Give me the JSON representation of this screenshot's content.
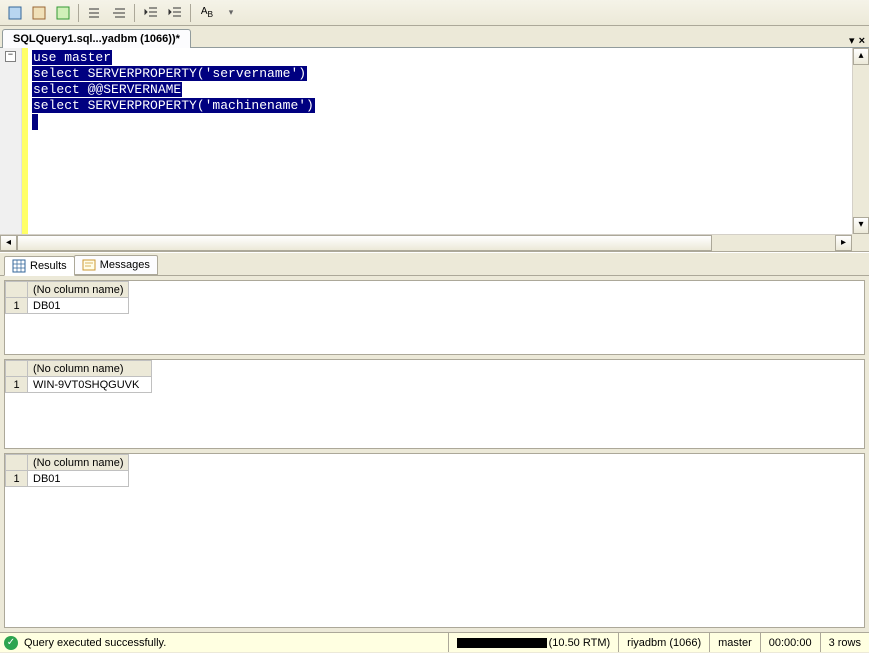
{
  "tab": {
    "title": "SQLQuery1.sql...yadbm (1066))*"
  },
  "code": {
    "line1": "use master",
    "line2": "select SERVERPROPERTY('servername')",
    "line3": "select @@SERVERNAME",
    "line4": "select SERVERPROPERTY('machinename')"
  },
  "results_tabs": {
    "results": "Results",
    "messages": "Messages"
  },
  "grid": {
    "nocol": "(No column name)",
    "r1_val": "DB01",
    "r2_val": "WIN-9VT0SHQGUVK",
    "r3_val": "DB01",
    "row1": "1"
  },
  "status": {
    "msg": "Query executed successfully.",
    "server": "(10.50 RTM)",
    "user": "riyadbm (1066)",
    "db": "master",
    "time": "00:00:00",
    "rows": "3 rows"
  }
}
